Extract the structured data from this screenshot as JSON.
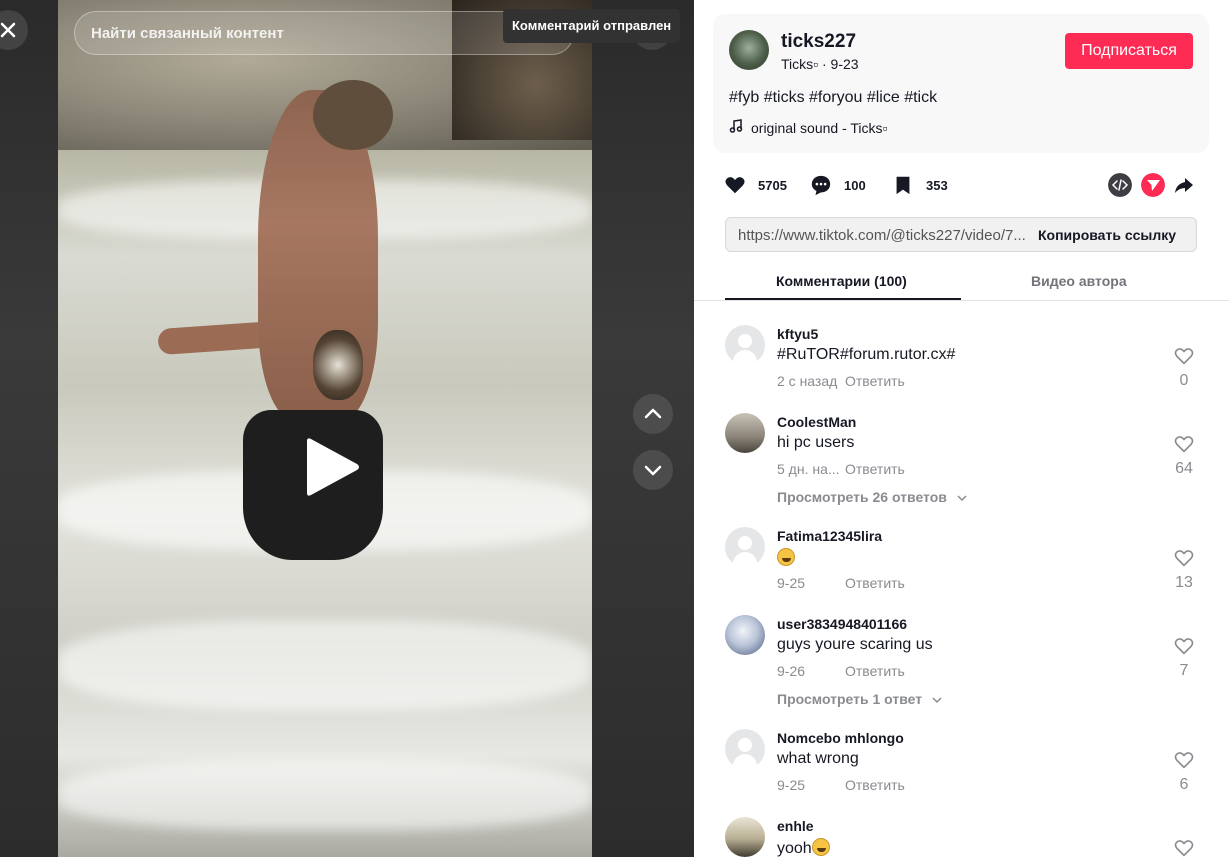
{
  "video": {
    "search_placeholder": "Найти связанный контент",
    "toast": "Комментарий отправлен"
  },
  "author": {
    "username": "ticks227",
    "display_sub": "Ticks▫ · 9-23",
    "follow_label": "Подписаться"
  },
  "post": {
    "description": "#fyb #ticks #foryou #lice #tick",
    "music": "original sound - Ticks▫"
  },
  "stats": {
    "likes": "5705",
    "comments": "100",
    "saves": "353"
  },
  "link": {
    "url": "https://www.tiktok.com/@ticks227/video/7...",
    "copy_label": "Копировать ссылку"
  },
  "tabs": {
    "comments": "Комментарии (100)",
    "author_videos": "Видео автора"
  },
  "comments": [
    {
      "user": "kftyu5",
      "text": "#RuTOR#forum.rutor.cx#",
      "time": "2 с назад",
      "reply": "Ответить",
      "likes": "0",
      "replies": ""
    },
    {
      "user": "CoolestMan",
      "text": "hi pc users",
      "time": "5 дн. на...",
      "reply": "Ответить",
      "likes": "64",
      "replies": "Просмотреть 26 ответов"
    },
    {
      "user": "Fatima12345lira",
      "text": "",
      "time": "9-25",
      "reply": "Ответить",
      "likes": "13",
      "replies": ""
    },
    {
      "user": "user3834948401166",
      "text": "guys youre scaring us",
      "time": "9-26",
      "reply": "Ответить",
      "likes": "7",
      "replies": "Просмотреть 1 ответ"
    },
    {
      "user": "Nomcebo mhlongo",
      "text": "what wrong",
      "time": "9-25",
      "reply": "Ответить",
      "likes": "6",
      "replies": ""
    },
    {
      "user": "enhle",
      "text": "yooh",
      "time": "",
      "reply": "",
      "likes": "",
      "replies": ""
    }
  ],
  "colors": {
    "brand": "#fe2c55",
    "text": "#161823",
    "muted": "#8a8b91"
  }
}
